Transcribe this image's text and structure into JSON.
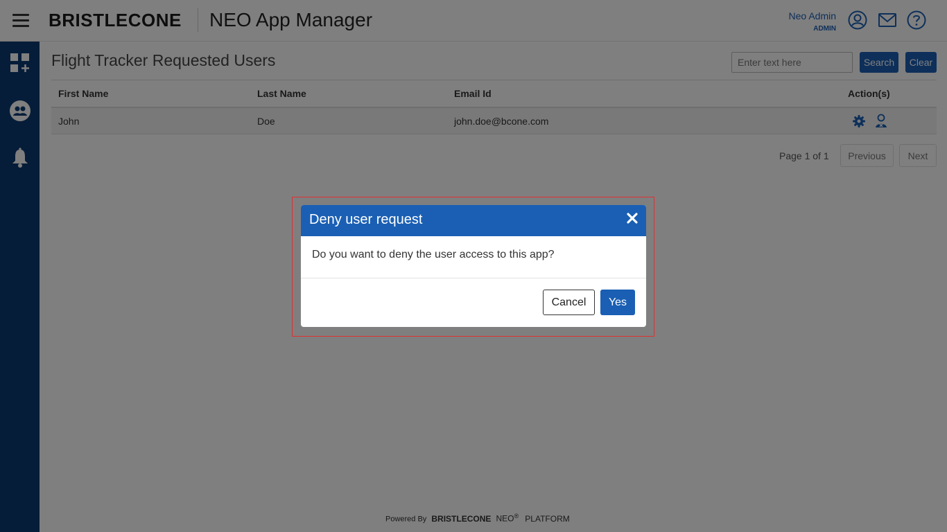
{
  "header": {
    "brand": "BRISTLECONE",
    "app_title": "NEO App Manager",
    "user_name": "Neo Admin",
    "user_role": "ADMIN",
    "icons": [
      "user-circle-icon",
      "mail-icon",
      "help-icon"
    ]
  },
  "sidebar": {
    "icons": [
      "dashboard-add-icon",
      "users-group-icon",
      "notification-bell-icon"
    ]
  },
  "main": {
    "page_title": "Flight Tracker Requested Users",
    "search": {
      "placeholder": "Enter text here",
      "value": ""
    },
    "search_button": "Search",
    "clear_button": "Clear",
    "table": {
      "headers": [
        "First Name",
        "Last Name",
        "Email Id",
        "Action(s)"
      ],
      "rows": [
        {
          "first_name": "John",
          "last_name": "Doe",
          "email": "john.doe@bcone.com",
          "actions": [
            "settings-gear-icon",
            "user-deny-icon"
          ]
        }
      ]
    },
    "pagination": {
      "text": "Page 1 of 1",
      "previous": "Previous",
      "next": "Next"
    }
  },
  "footer": {
    "powered_by": "Powered By",
    "brand": "BRISTLECONE",
    "neo": "NEO",
    "registered": "®",
    "platform": "PLATFORM"
  },
  "modal": {
    "title": "Deny user request",
    "message": "Do you want to deny the user access to this app?",
    "cancel_label": "Cancel",
    "yes_label": "Yes"
  },
  "colors": {
    "primary": "#1a5fb4",
    "sidebar": "#0d3b73",
    "highlight": "#e03030"
  }
}
